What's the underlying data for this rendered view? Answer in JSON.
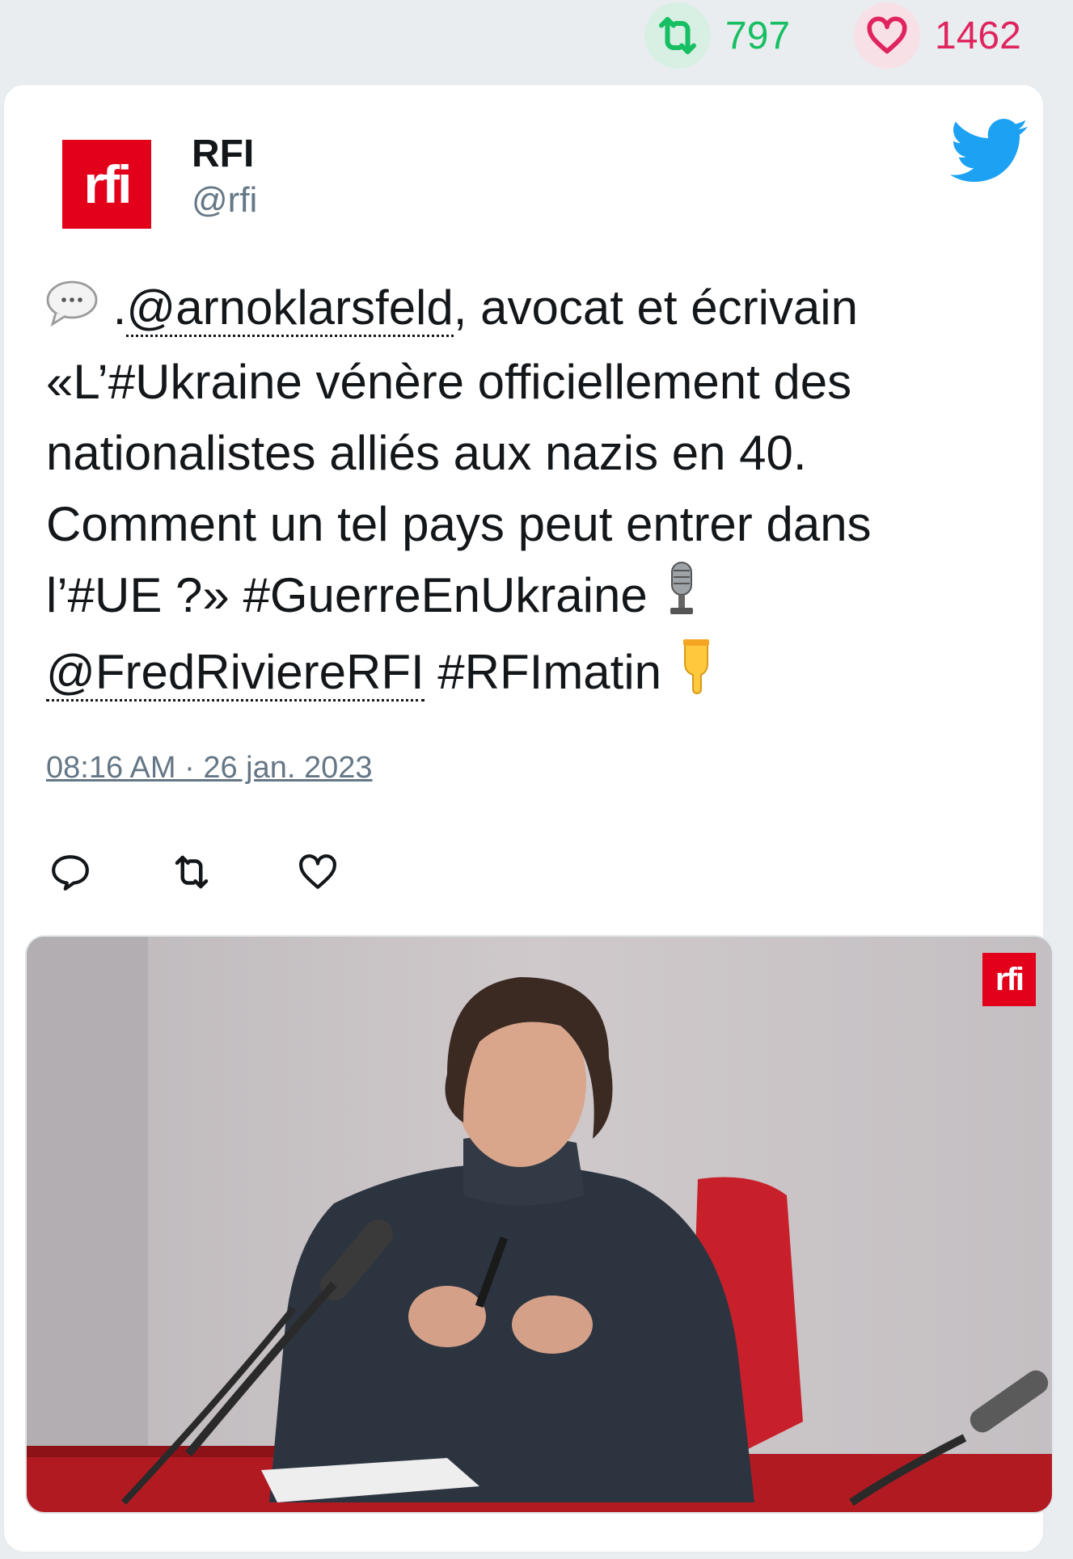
{
  "stats": {
    "retweets": "797",
    "likes": "1462",
    "retweet_color": "#17bf63",
    "like_color": "#e0245e"
  },
  "tweet": {
    "author_name": "RFI",
    "author_handle": "@rfi",
    "avatar_text": "rfi",
    "lines": {
      "l1_prefix": " .",
      "l1_mention": "@arnoklarsfeld",
      "l1_rest": ", avocat et écrivain",
      "l2": "«L’#Ukraine vénère officiellement des",
      "l3": "nationalistes alliés aux nazis en 40.",
      "l4": "Comment un tel pays peut entrer dans",
      "l5": "l’#UE ?» #GuerreEnUkraine ",
      "l6_mention": "@FredRiviereRFI",
      "l6_rest": " #RFImatin "
    },
    "timestamp": "08:16 AM · 26 jan. 2023",
    "icons": {
      "speech": "speech-balloon-icon",
      "mic": "microphone-icon",
      "pointing": "pointing-down-icon",
      "platform": "twitter-bird-icon"
    }
  },
  "media": {
    "logo_text": "rfi",
    "brand_color": "#e2001a"
  }
}
